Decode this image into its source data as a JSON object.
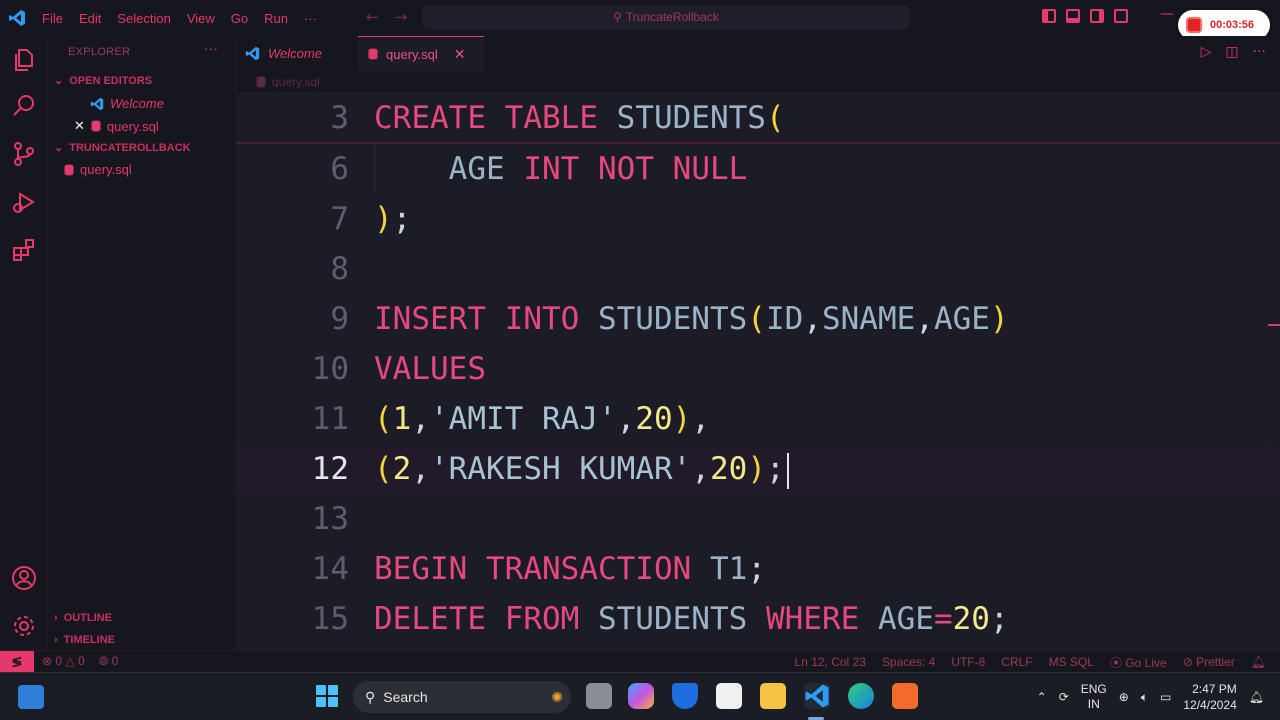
{
  "window": {
    "menu": [
      "File",
      "Edit",
      "Selection",
      "View",
      "Go",
      "Run",
      "···"
    ],
    "command_center": "TruncateRollback",
    "recording_time": "00:03:56"
  },
  "activity_bar": {
    "icons": [
      "files-icon",
      "search-icon",
      "source-control-icon",
      "run-debug-icon",
      "extensions-icon",
      "account-icon",
      "settings-gear-icon"
    ]
  },
  "sidebar": {
    "title": "EXPLORER",
    "more": "···",
    "open_editors_label": "OPEN EDITORS",
    "open_editors": [
      {
        "label": "Welcome",
        "icon": "vscode-icon"
      },
      {
        "label": "query.sql",
        "icon": "database-icon"
      }
    ],
    "folder_label": "TRUNCATEROLLBACK",
    "folder_items": [
      {
        "label": "query.sql",
        "icon": "database-icon"
      }
    ],
    "outline_label": "OUTLINE",
    "timeline_label": "TIMELINE"
  },
  "tabs": [
    {
      "label": "Welcome",
      "active": false
    },
    {
      "label": "query.sql",
      "active": true
    }
  ],
  "breadcrumb": "query.sql",
  "editor": {
    "sticky_line": {
      "num": "3",
      "tokens": [
        [
          "kw",
          "CREATE"
        ],
        [
          "plain",
          " "
        ],
        [
          "kw",
          "TABLE"
        ],
        [
          "plain",
          " "
        ],
        [
          "id",
          "STUDENTS"
        ],
        [
          "pn",
          "("
        ]
      ]
    },
    "lines": [
      {
        "num": "6",
        "tokens": [
          [
            "plain",
            "    "
          ],
          [
            "id",
            "AGE"
          ],
          [
            "plain",
            " "
          ],
          [
            "kw",
            "INT"
          ],
          [
            "plain",
            " "
          ],
          [
            "kw",
            "NOT"
          ],
          [
            "plain",
            " "
          ],
          [
            "kw",
            "NULL"
          ]
        ]
      },
      {
        "num": "7",
        "tokens": [
          [
            "pn",
            ")"
          ],
          [
            "plain",
            ";"
          ]
        ]
      },
      {
        "num": "8",
        "tokens": []
      },
      {
        "num": "9",
        "tokens": [
          [
            "kw",
            "INSERT"
          ],
          [
            "plain",
            " "
          ],
          [
            "kw",
            "INTO"
          ],
          [
            "plain",
            " "
          ],
          [
            "id",
            "STUDENTS"
          ],
          [
            "pn",
            "("
          ],
          [
            "id",
            "ID"
          ],
          [
            "plain",
            ","
          ],
          [
            "id",
            "SNAME"
          ],
          [
            "plain",
            ","
          ],
          [
            "id",
            "AGE"
          ],
          [
            "pn",
            ")"
          ]
        ]
      },
      {
        "num": "10",
        "tokens": [
          [
            "kw",
            "VALUES"
          ]
        ]
      },
      {
        "num": "11",
        "tokens": [
          [
            "pn",
            "("
          ],
          [
            "num",
            "1"
          ],
          [
            "plain",
            ","
          ],
          [
            "str",
            "'AMIT RAJ'"
          ],
          [
            "plain",
            ","
          ],
          [
            "num",
            "20"
          ],
          [
            "pn",
            ")"
          ],
          [
            "plain",
            ","
          ]
        ]
      },
      {
        "num": "12",
        "tokens": [
          [
            "pn",
            "("
          ],
          [
            "num",
            "2"
          ],
          [
            "plain",
            ","
          ],
          [
            "str",
            "'RAKESH KUMAR'"
          ],
          [
            "plain",
            ","
          ],
          [
            "num",
            "20"
          ],
          [
            "pn",
            ")"
          ],
          [
            "plain",
            ";"
          ]
        ],
        "current": true
      },
      {
        "num": "13",
        "tokens": []
      },
      {
        "num": "14",
        "tokens": [
          [
            "kw",
            "BEGIN"
          ],
          [
            "plain",
            " "
          ],
          [
            "kw",
            "TRANSACTION"
          ],
          [
            "plain",
            " "
          ],
          [
            "id",
            "T1"
          ],
          [
            "plain",
            ";"
          ]
        ]
      },
      {
        "num": "15",
        "tokens": [
          [
            "kw",
            "DELETE"
          ],
          [
            "plain",
            " "
          ],
          [
            "kw",
            "FROM"
          ],
          [
            "plain",
            " "
          ],
          [
            "id",
            "STUDENTS"
          ],
          [
            "plain",
            " "
          ],
          [
            "kw",
            "WHERE"
          ],
          [
            "plain",
            " "
          ],
          [
            "id",
            "AGE"
          ],
          [
            "kw",
            "="
          ],
          [
            "num",
            "20"
          ],
          [
            "plain",
            ";"
          ]
        ]
      }
    ]
  },
  "status": {
    "errors": "0",
    "warnings": "0",
    "ports": "0",
    "position": "Ln 12, Col 23",
    "spaces": "Spaces: 4",
    "encoding": "UTF-8",
    "eol": "CRLF",
    "language": "MS SQL",
    "go_live": "Go Live",
    "prettier": "Prettier"
  },
  "taskbar": {
    "search_label": "Search",
    "lang_top": "ENG",
    "lang_bottom": "IN",
    "time": "2:47 PM",
    "date": "12/4/2024"
  },
  "colors": {
    "accent": "#e5386b",
    "keyword": "#e5497d",
    "identifier": "#9bb3c6",
    "bracket": "#f5d43c",
    "number": "#f2e98a",
    "editor_bg": "#1c1c27"
  }
}
